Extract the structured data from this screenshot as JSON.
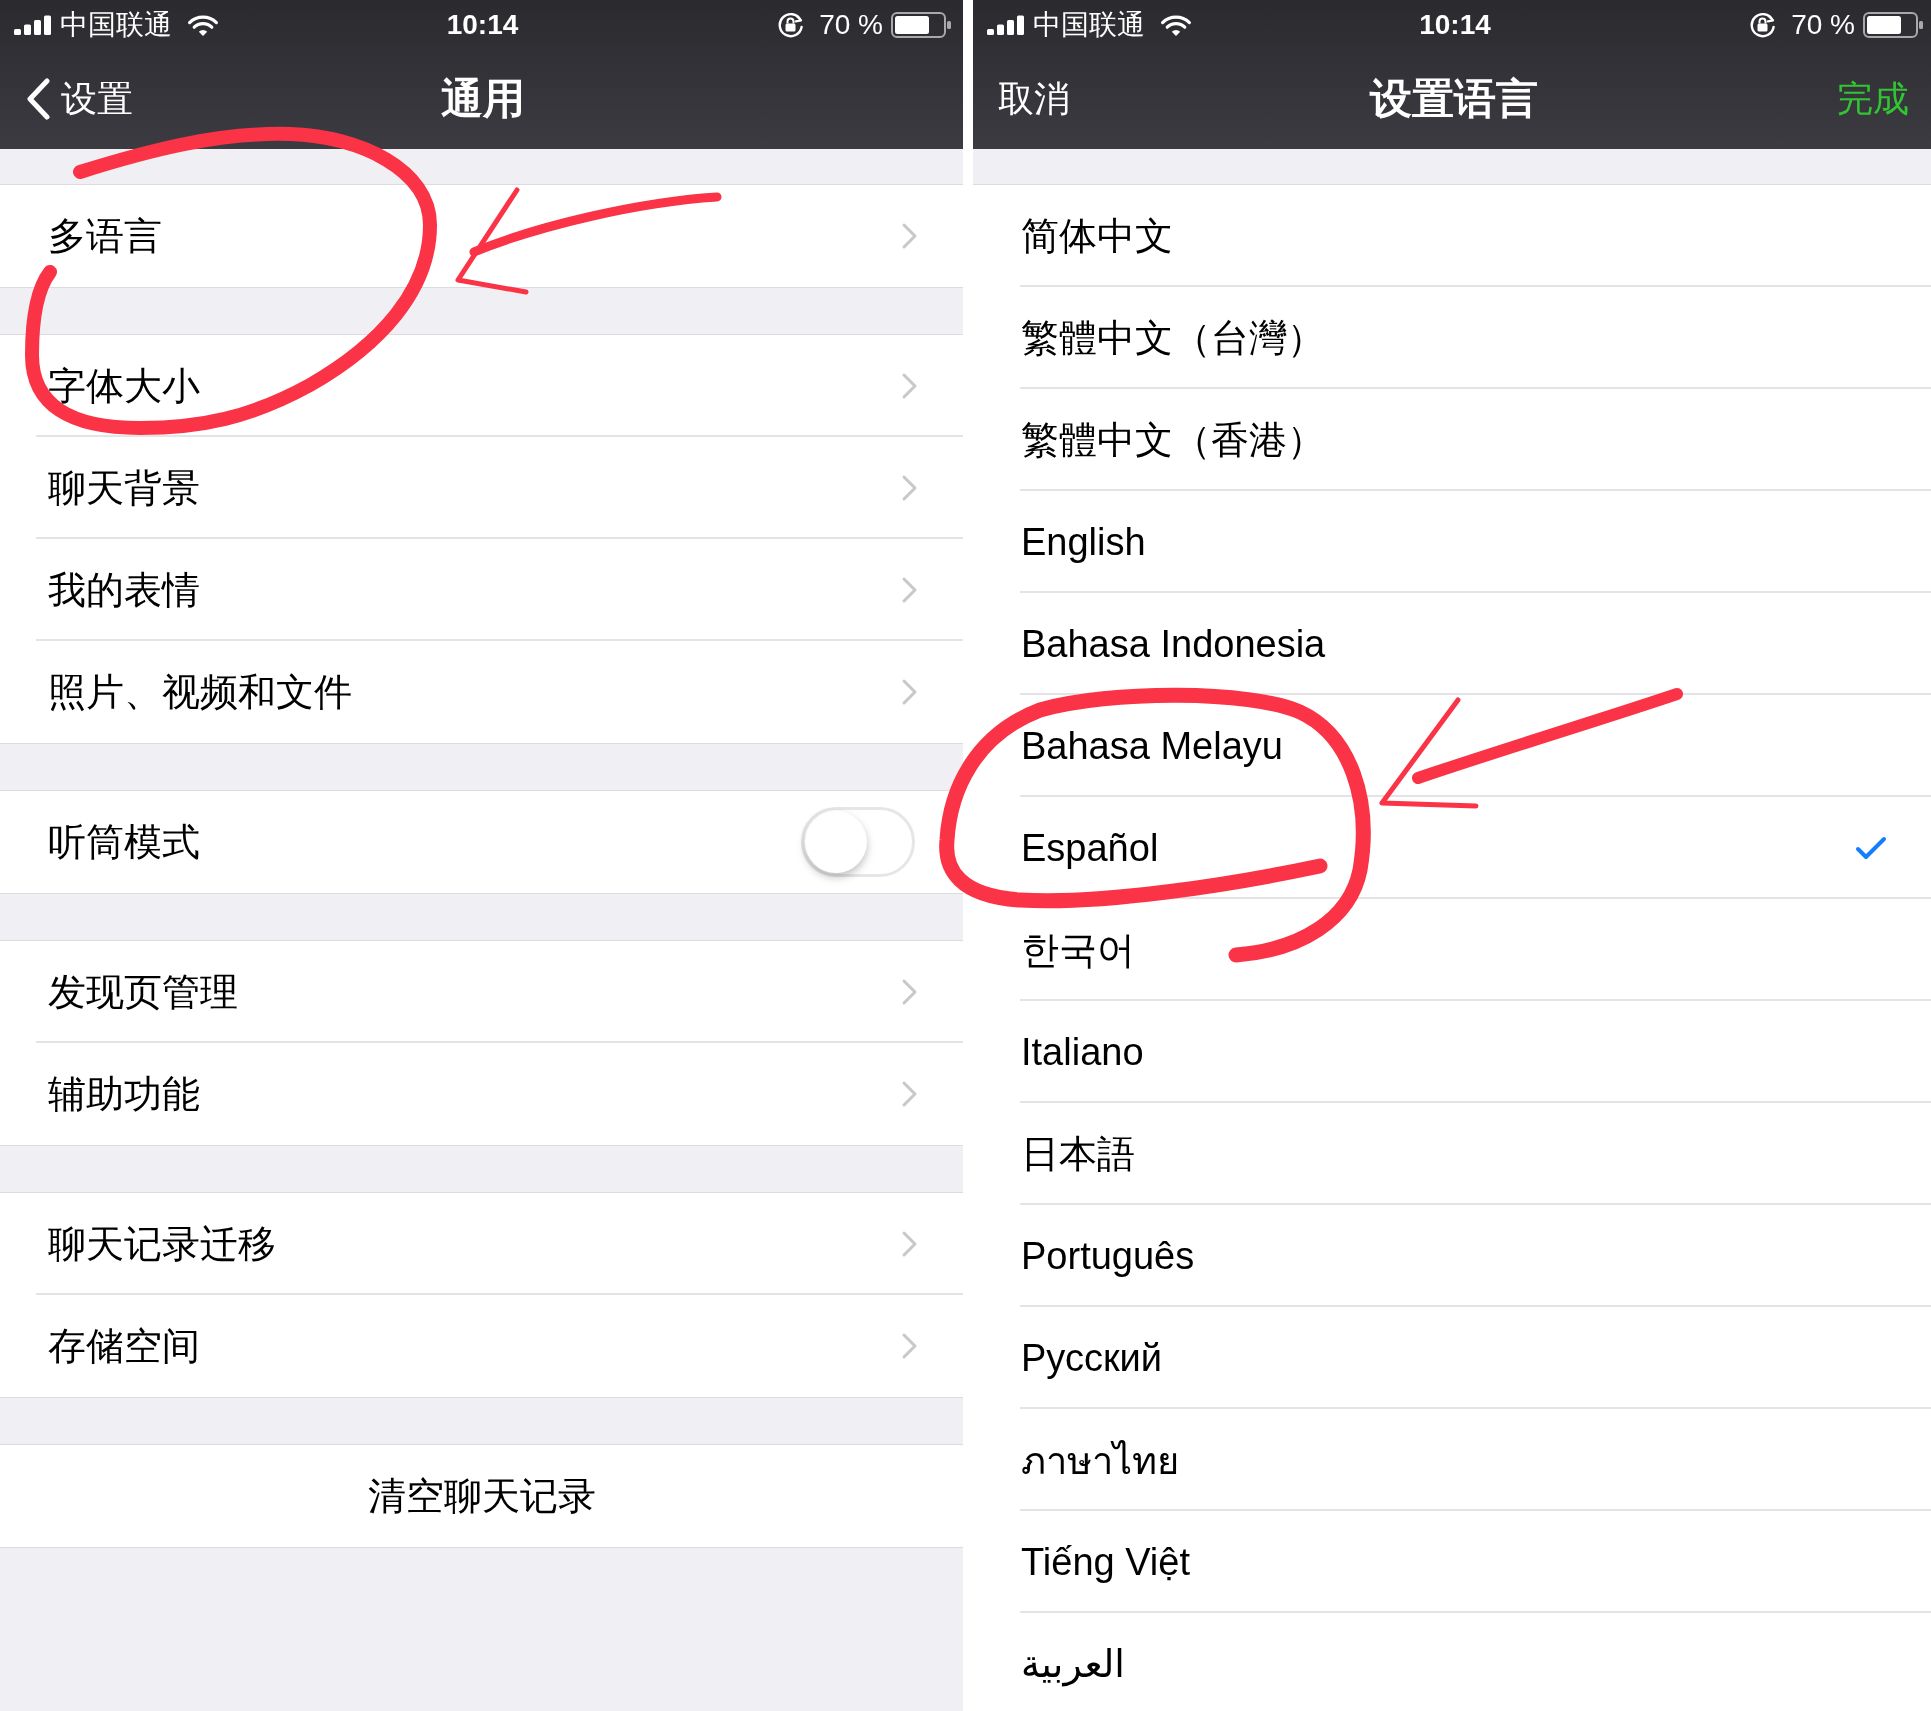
{
  "general_screen": {
    "status_bar": {
      "carrier": "中国联通",
      "time": "10:14",
      "battery": "70 %"
    },
    "nav_bar": {
      "back": "设置",
      "title": "通用"
    },
    "groups": [
      {
        "rows": [
          {
            "kind": "link",
            "label": "多语言"
          }
        ]
      },
      {
        "rows": [
          {
            "kind": "link",
            "label": "字体大小"
          },
          {
            "kind": "link",
            "label": "聊天背景"
          },
          {
            "kind": "link",
            "label": "我的表情"
          },
          {
            "kind": "link",
            "label": "照片、视频和文件"
          }
        ]
      },
      {
        "rows": [
          {
            "kind": "toggle",
            "label": "听筒模式",
            "on": false
          }
        ]
      },
      {
        "rows": [
          {
            "kind": "link",
            "label": "发现页管理"
          },
          {
            "kind": "link",
            "label": "辅助功能"
          }
        ]
      },
      {
        "rows": [
          {
            "kind": "link",
            "label": "聊天记录迁移"
          },
          {
            "kind": "link",
            "label": "存储空间"
          }
        ]
      },
      {
        "rows": [
          {
            "kind": "action",
            "label": "清空聊天记录"
          }
        ]
      }
    ]
  },
  "language_screen": {
    "status_bar": {
      "carrier": "中国联通",
      "time": "10:14",
      "battery": "70 %"
    },
    "nav_bar": {
      "cancel": "取消",
      "title": "设置语言",
      "done": "完成"
    },
    "languages": [
      {
        "label": "简体中文",
        "selected": false
      },
      {
        "label": "繁體中文（台灣）",
        "selected": false
      },
      {
        "label": "繁體中文（香港）",
        "selected": false
      },
      {
        "label": "English",
        "selected": false
      },
      {
        "label": "Bahasa Indonesia",
        "selected": false
      },
      {
        "label": "Bahasa Melayu",
        "selected": false
      },
      {
        "label": "Español",
        "selected": true
      },
      {
        "label": "한국어",
        "selected": false
      },
      {
        "label": "Italiano",
        "selected": false
      },
      {
        "label": "日本語",
        "selected": false
      },
      {
        "label": "Português",
        "selected": false
      },
      {
        "label": "Русский",
        "selected": false
      },
      {
        "label": "ภาษาไทย",
        "selected": false
      },
      {
        "label": "Tiếng Việt",
        "selected": false
      },
      {
        "label": "العربية",
        "selected": false
      }
    ]
  }
}
